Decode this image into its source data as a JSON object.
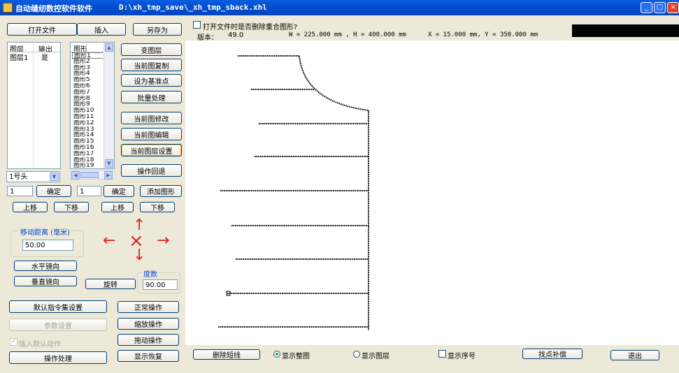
{
  "window": {
    "title": "自动缝纫数控软件软件",
    "path": "D:\\xh_tmp_save\\_xh_tmp_sback.xhl",
    "min_glyph": "_",
    "max_glyph": "□",
    "close_glyph": "×"
  },
  "toolbar": {
    "open_file": "打开文件",
    "insert": "插入",
    "save_as": "另存为"
  },
  "options": {
    "delete_overlap_label": "打开文件时是否删除重合图形?"
  },
  "info": {
    "version_label": "版本：",
    "version_value": "49.0",
    "wh_text": "W = 225.000 mm , H = 400.000 mm",
    "xy_text": "X = 15.000 mm, Y = 350.000 mm"
  },
  "layers": {
    "col_layer": "图层",
    "col_output": "输出",
    "rows": [
      {
        "layer": "图层1",
        "output": "是"
      }
    ]
  },
  "shapes": {
    "header": "图形",
    "items": [
      "图形1",
      "图形2",
      "图形3",
      "图形4",
      "图形5",
      "图形6",
      "图形7",
      "图形8",
      "图形9",
      "图形10",
      "图形11",
      "图形12",
      "图形13",
      "图形14",
      "图形15",
      "图形16",
      "图形17",
      "图形18",
      "图形19"
    ]
  },
  "side_buttons": {
    "change_layer": "变图层",
    "copy_current": "当前图复制",
    "set_base_point": "设为基准点",
    "batch": "批量处理",
    "modify_current": "当前图修改",
    "edit_current": "当前图编辑",
    "layer_settings": "当前图层设置",
    "undo": "操作回退"
  },
  "head_select": {
    "value": "1号头"
  },
  "inputs": {
    "layer_num": "1",
    "shape_num": "1",
    "move_distance": "50.00",
    "degree": "90.00"
  },
  "buttons": {
    "confirm1": "确定",
    "confirm2": "确定",
    "add_shape": "添加图形",
    "up1": "上移",
    "down1": "下移",
    "up2": "上移",
    "down2": "下移",
    "hmirror": "水平镜向",
    "vmirror": "垂直镜向",
    "rotate": "旋转",
    "default_cmd": "默认指令集设置",
    "param_settings": "参数设置",
    "normal_op": "正常操作",
    "zoom_op": "缩放操作",
    "drag_op": "拖动操作",
    "op_process": "操作处理",
    "display_restore": "显示恢复",
    "delete_short": "删除短线",
    "point_compensate": "找点补偿",
    "exit": "退出"
  },
  "labels": {
    "move_distance": "移动距离 (毫米)",
    "degree": "度数",
    "insert_default": "插入默认动作",
    "show_whole": "显示整图",
    "show_layer": "显示图层",
    "show_seq": "显示序号"
  },
  "arrows": {
    "up": "↑",
    "down": "↓",
    "left": "←",
    "right": "→",
    "center": "×"
  },
  "colors": {
    "title_blue": "#0450d0",
    "arrow_red": "#e02020",
    "stitch": "#000000"
  }
}
